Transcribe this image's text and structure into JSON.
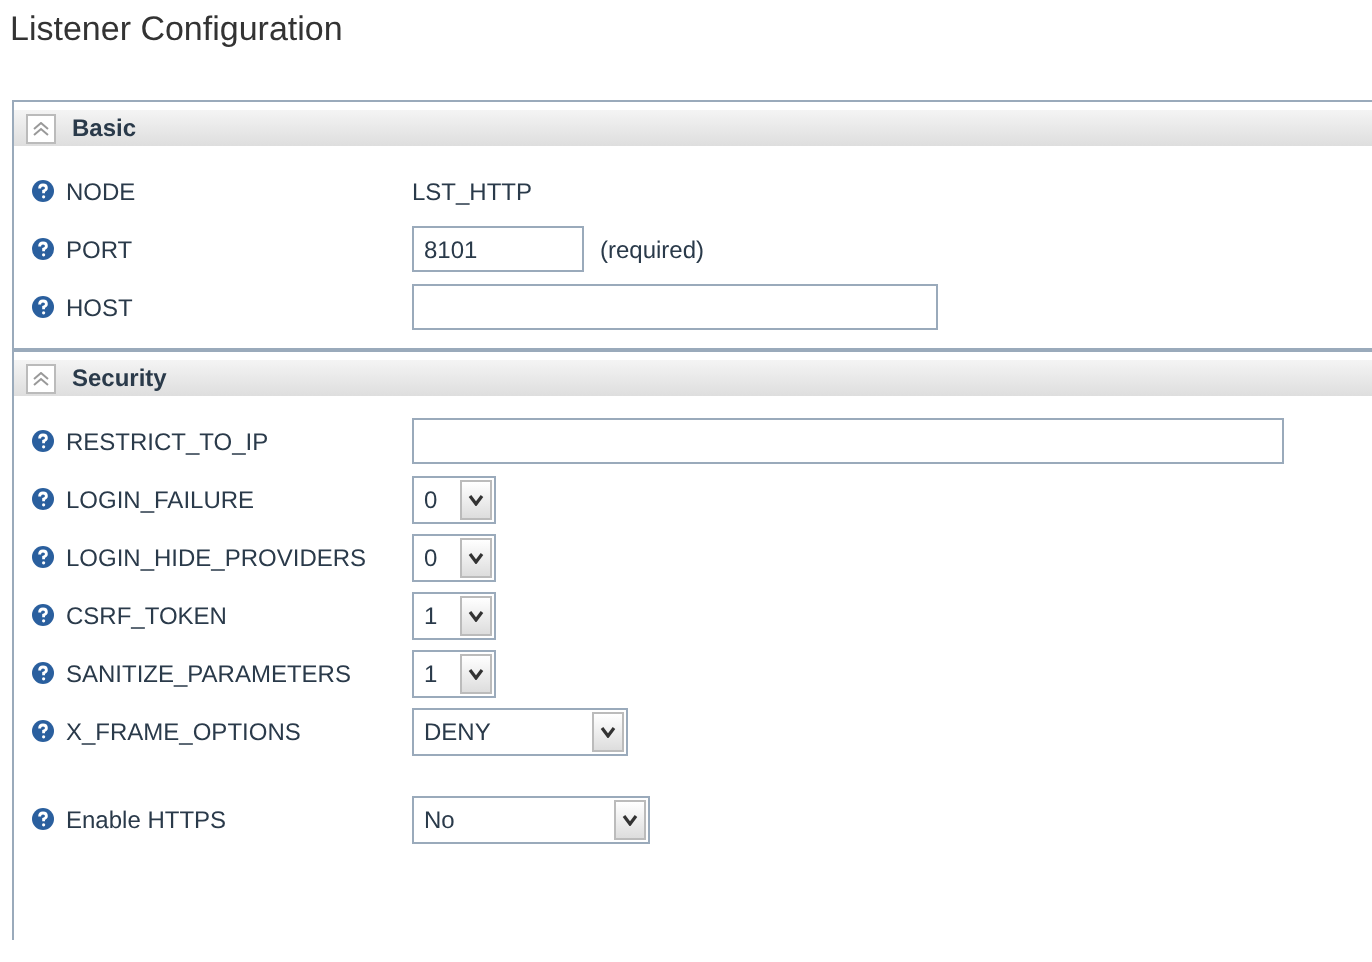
{
  "title": "Listener Configuration",
  "sections": [
    {
      "title": "Basic",
      "expanded": true,
      "fields": [
        {
          "label": "NODE",
          "kind": "text",
          "value": "LST_HTTP"
        },
        {
          "label": "PORT",
          "kind": "input",
          "value": "8101",
          "note": "(required)"
        },
        {
          "label": "HOST",
          "kind": "input"
        }
      ]
    },
    {
      "title": "Security",
      "expanded": true,
      "fields": [
        {
          "label": "RESTRICT_TO_IP",
          "kind": "input"
        },
        {
          "label": "LOGIN_FAILURE",
          "kind": "select",
          "value": "0"
        },
        {
          "label": "LOGIN_HIDE_PROVIDERS",
          "kind": "select",
          "value": "0"
        },
        {
          "label": "CSRF_TOKEN",
          "kind": "select",
          "value": "1"
        },
        {
          "label": "SANITIZE_PARAMETERS",
          "kind": "select",
          "value": "1"
        },
        {
          "label": "X_FRAME_OPTIONS",
          "kind": "select",
          "value": "DENY"
        },
        {
          "label": "Enable HTTPS",
          "kind": "select",
          "value": "No"
        }
      ]
    }
  ]
}
